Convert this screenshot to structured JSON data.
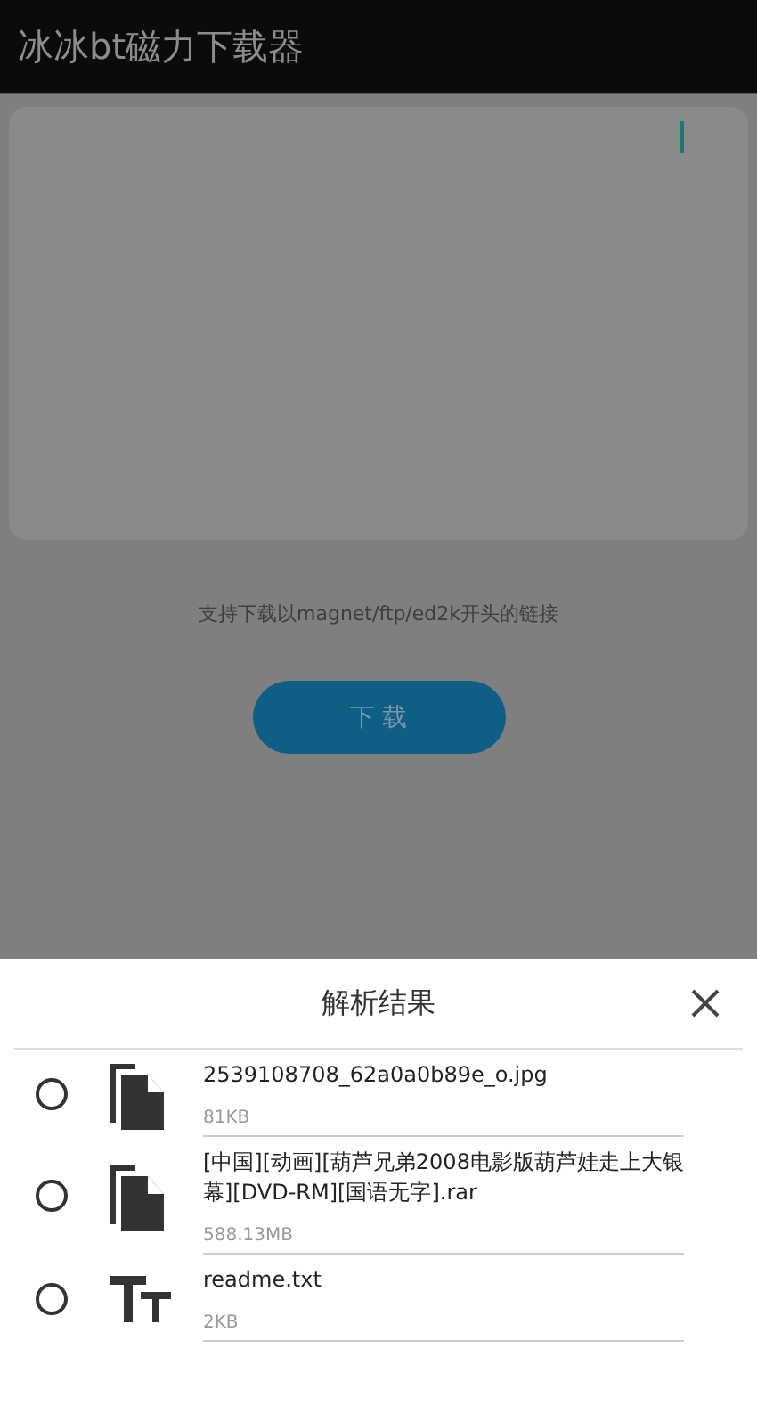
{
  "app_bar": {
    "title": "冰冰bt磁力下载器"
  },
  "link_input": {
    "focused": true
  },
  "hint": "支持下载以magnet/ftp/ed2k开头的链接",
  "download_button": "下 载",
  "result_sheet": {
    "title": "解析结果",
    "files": [
      {
        "kind": "file",
        "name": "2539108708_62a0a0b89e_o.jpg",
        "size": "81KB",
        "selected": false
      },
      {
        "kind": "file",
        "name": "[中国][动画][葫芦兄弟2008电影版葫芦娃走上大银幕][DVD-RM][国语无字].rar",
        "size": "588.13MB",
        "selected": false
      },
      {
        "kind": "text",
        "name": "readme.txt",
        "size": "2KB",
        "selected": false
      }
    ]
  }
}
